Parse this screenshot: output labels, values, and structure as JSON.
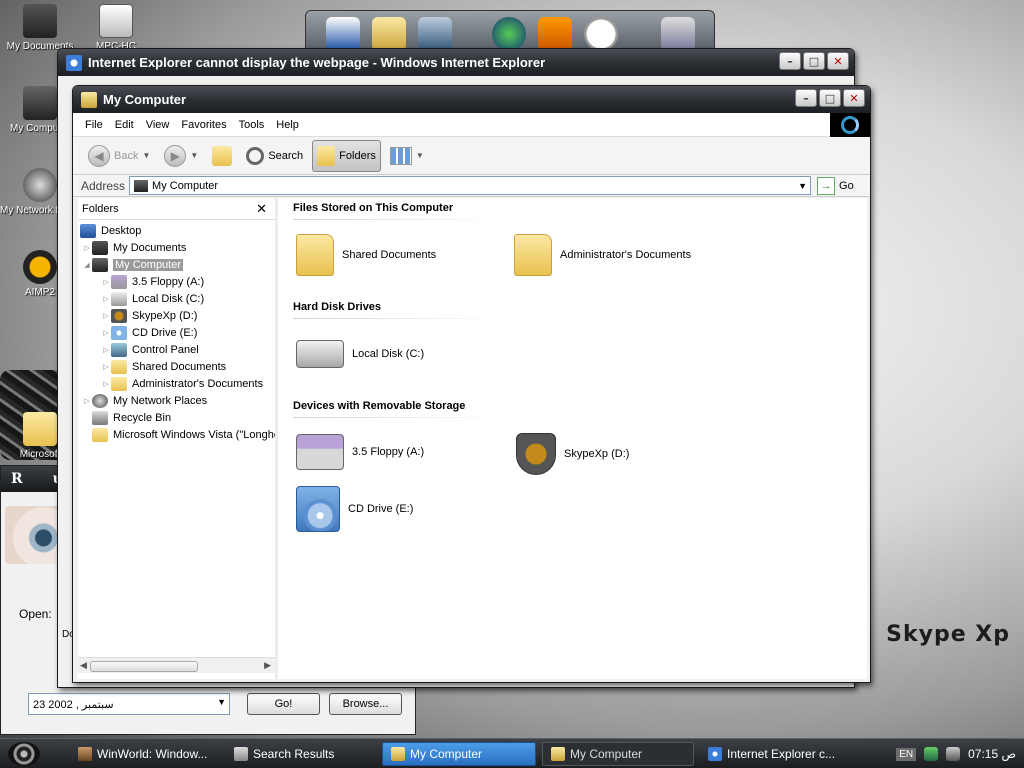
{
  "desktop": {
    "icons": [
      {
        "label": "My Documents"
      },
      {
        "label": "MPC-HC"
      },
      {
        "label": "My Computer"
      },
      {
        "label": "My Network Places"
      },
      {
        "label": "AIMP2"
      },
      {
        "label": "Microsoft"
      }
    ],
    "brand": "Skype Xp"
  },
  "ie_window": {
    "title": "Internet Explorer cannot display the webpage - Windows Internet Explorer",
    "status": "Do"
  },
  "run_dialog": {
    "title_letters": [
      "R",
      "u"
    ],
    "open_label": "Open:",
    "date_value": "23 سبتمبر , 2002",
    "go_label": "Go!",
    "browse_label": "Browse..."
  },
  "my_computer": {
    "title": "My Computer",
    "menu": [
      "File",
      "Edit",
      "View",
      "Favorites",
      "Tools",
      "Help"
    ],
    "toolbar": {
      "back": "Back",
      "search": "Search",
      "folders": "Folders"
    },
    "address": {
      "label": "Address",
      "value": "My Computer",
      "go": "Go"
    },
    "folders_pane": {
      "title": "Folders",
      "tree": [
        {
          "label": "Desktop"
        },
        {
          "label": "My Documents"
        },
        {
          "label": "My Computer"
        },
        {
          "label": "3.5 Floppy (A:)"
        },
        {
          "label": "Local Disk (C:)"
        },
        {
          "label": "SkypeXp (D:)"
        },
        {
          "label": "CD Drive (E:)"
        },
        {
          "label": "Control Panel"
        },
        {
          "label": "Shared Documents"
        },
        {
          "label": "Administrator's Documents"
        },
        {
          "label": "My Network Places"
        },
        {
          "label": "Recycle Bin"
        },
        {
          "label": "Microsoft Windows Vista (\"Longho"
        }
      ]
    },
    "groups": {
      "files": {
        "header": "Files Stored on This Computer",
        "items": [
          {
            "label": "Shared Documents"
          },
          {
            "label": "Administrator's Documents"
          }
        ]
      },
      "hdd": {
        "header": "Hard Disk Drives",
        "items": [
          {
            "label": "Local Disk (C:)"
          }
        ]
      },
      "removable": {
        "header": "Devices with Removable Storage",
        "items": [
          {
            "label": "3.5 Floppy (A:)"
          },
          {
            "label": "SkypeXp (D:)"
          },
          {
            "label": "CD Drive (E:)"
          }
        ]
      }
    }
  },
  "taskbar": {
    "tasks": [
      {
        "label": "WinWorld: Window..."
      },
      {
        "label": "Search Results"
      },
      {
        "label": "My Computer"
      },
      {
        "label": "My Computer"
      },
      {
        "label": "Internet Explorer c..."
      }
    ],
    "lang": "EN",
    "clock": "07:15 ص"
  },
  "colors": {
    "active_task": "#2a6fc0",
    "titlebar": "#2c3035",
    "selection": "#9a9a9a"
  }
}
